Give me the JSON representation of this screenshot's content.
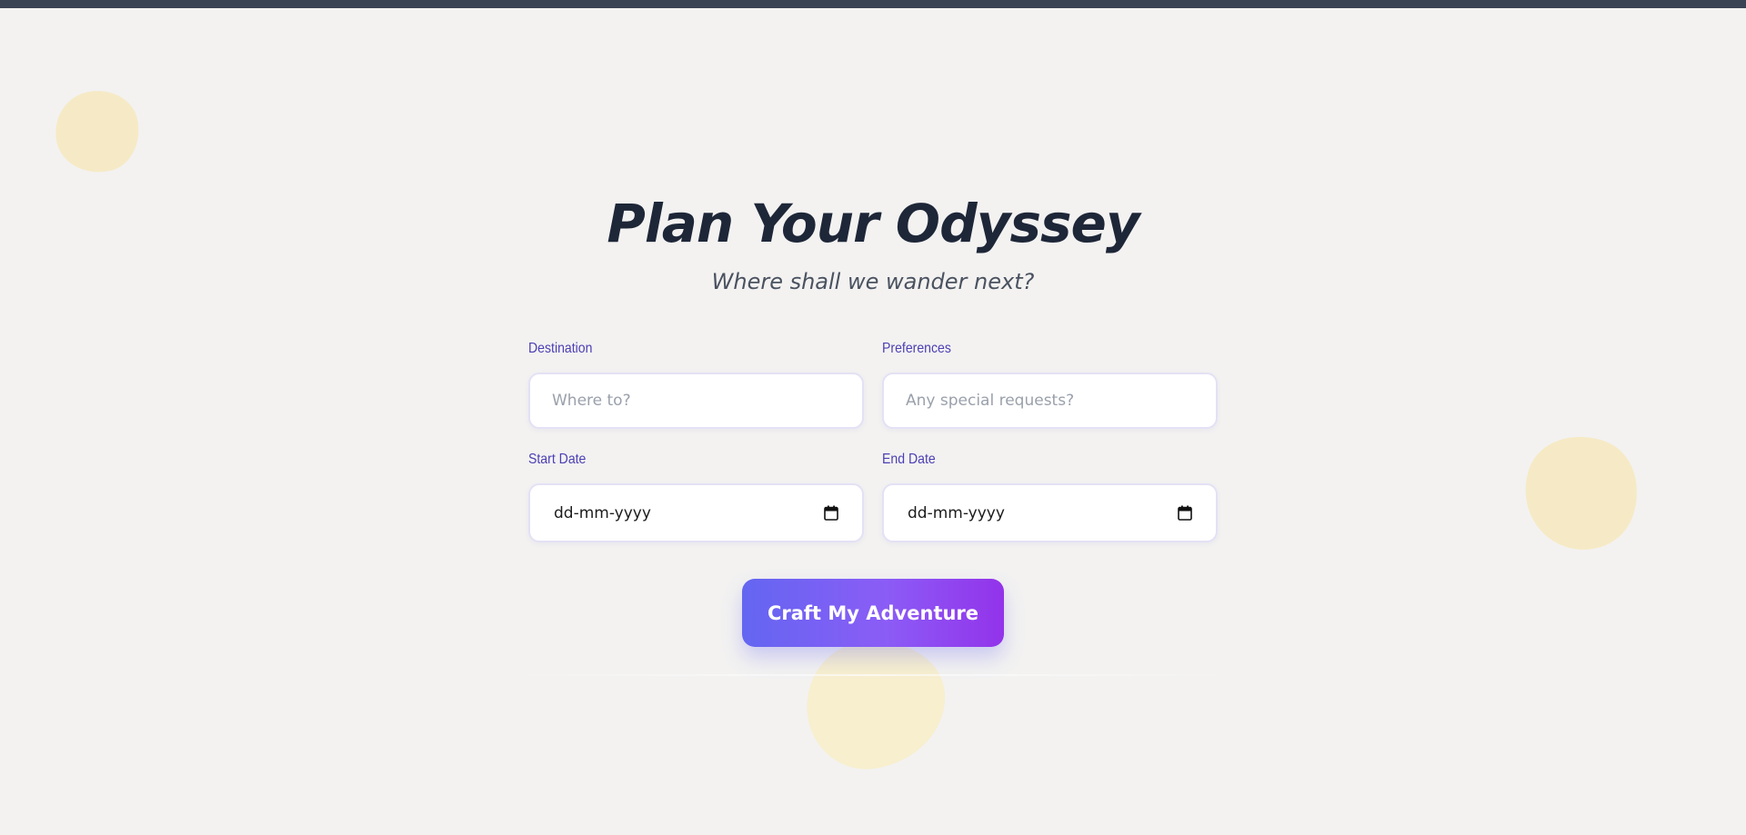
{
  "theme": {
    "background": "#f3f2f1",
    "top_bar": "#3a4354",
    "blob": "#f6e9c3",
    "label_color": "#4b3fb4",
    "title_color": "#1e2738",
    "button_gradient_start": "#6366f1",
    "button_gradient_end": "#9333ea"
  },
  "header": {
    "title": "Plan Your Odyssey",
    "subtitle": "Where shall we wander next?"
  },
  "form": {
    "destination": {
      "label": "Destination",
      "placeholder": "Where to?",
      "value": ""
    },
    "preferences": {
      "label": "Preferences",
      "placeholder": "Any special requests?",
      "value": ""
    },
    "start_date": {
      "label": "Start Date",
      "placeholder": "dd-mm-yyyy",
      "icon": "calendar-icon"
    },
    "end_date": {
      "label": "End Date",
      "placeholder": "dd-mm-yyyy",
      "icon": "calendar-icon"
    },
    "submit_label": "Craft My Adventure"
  }
}
